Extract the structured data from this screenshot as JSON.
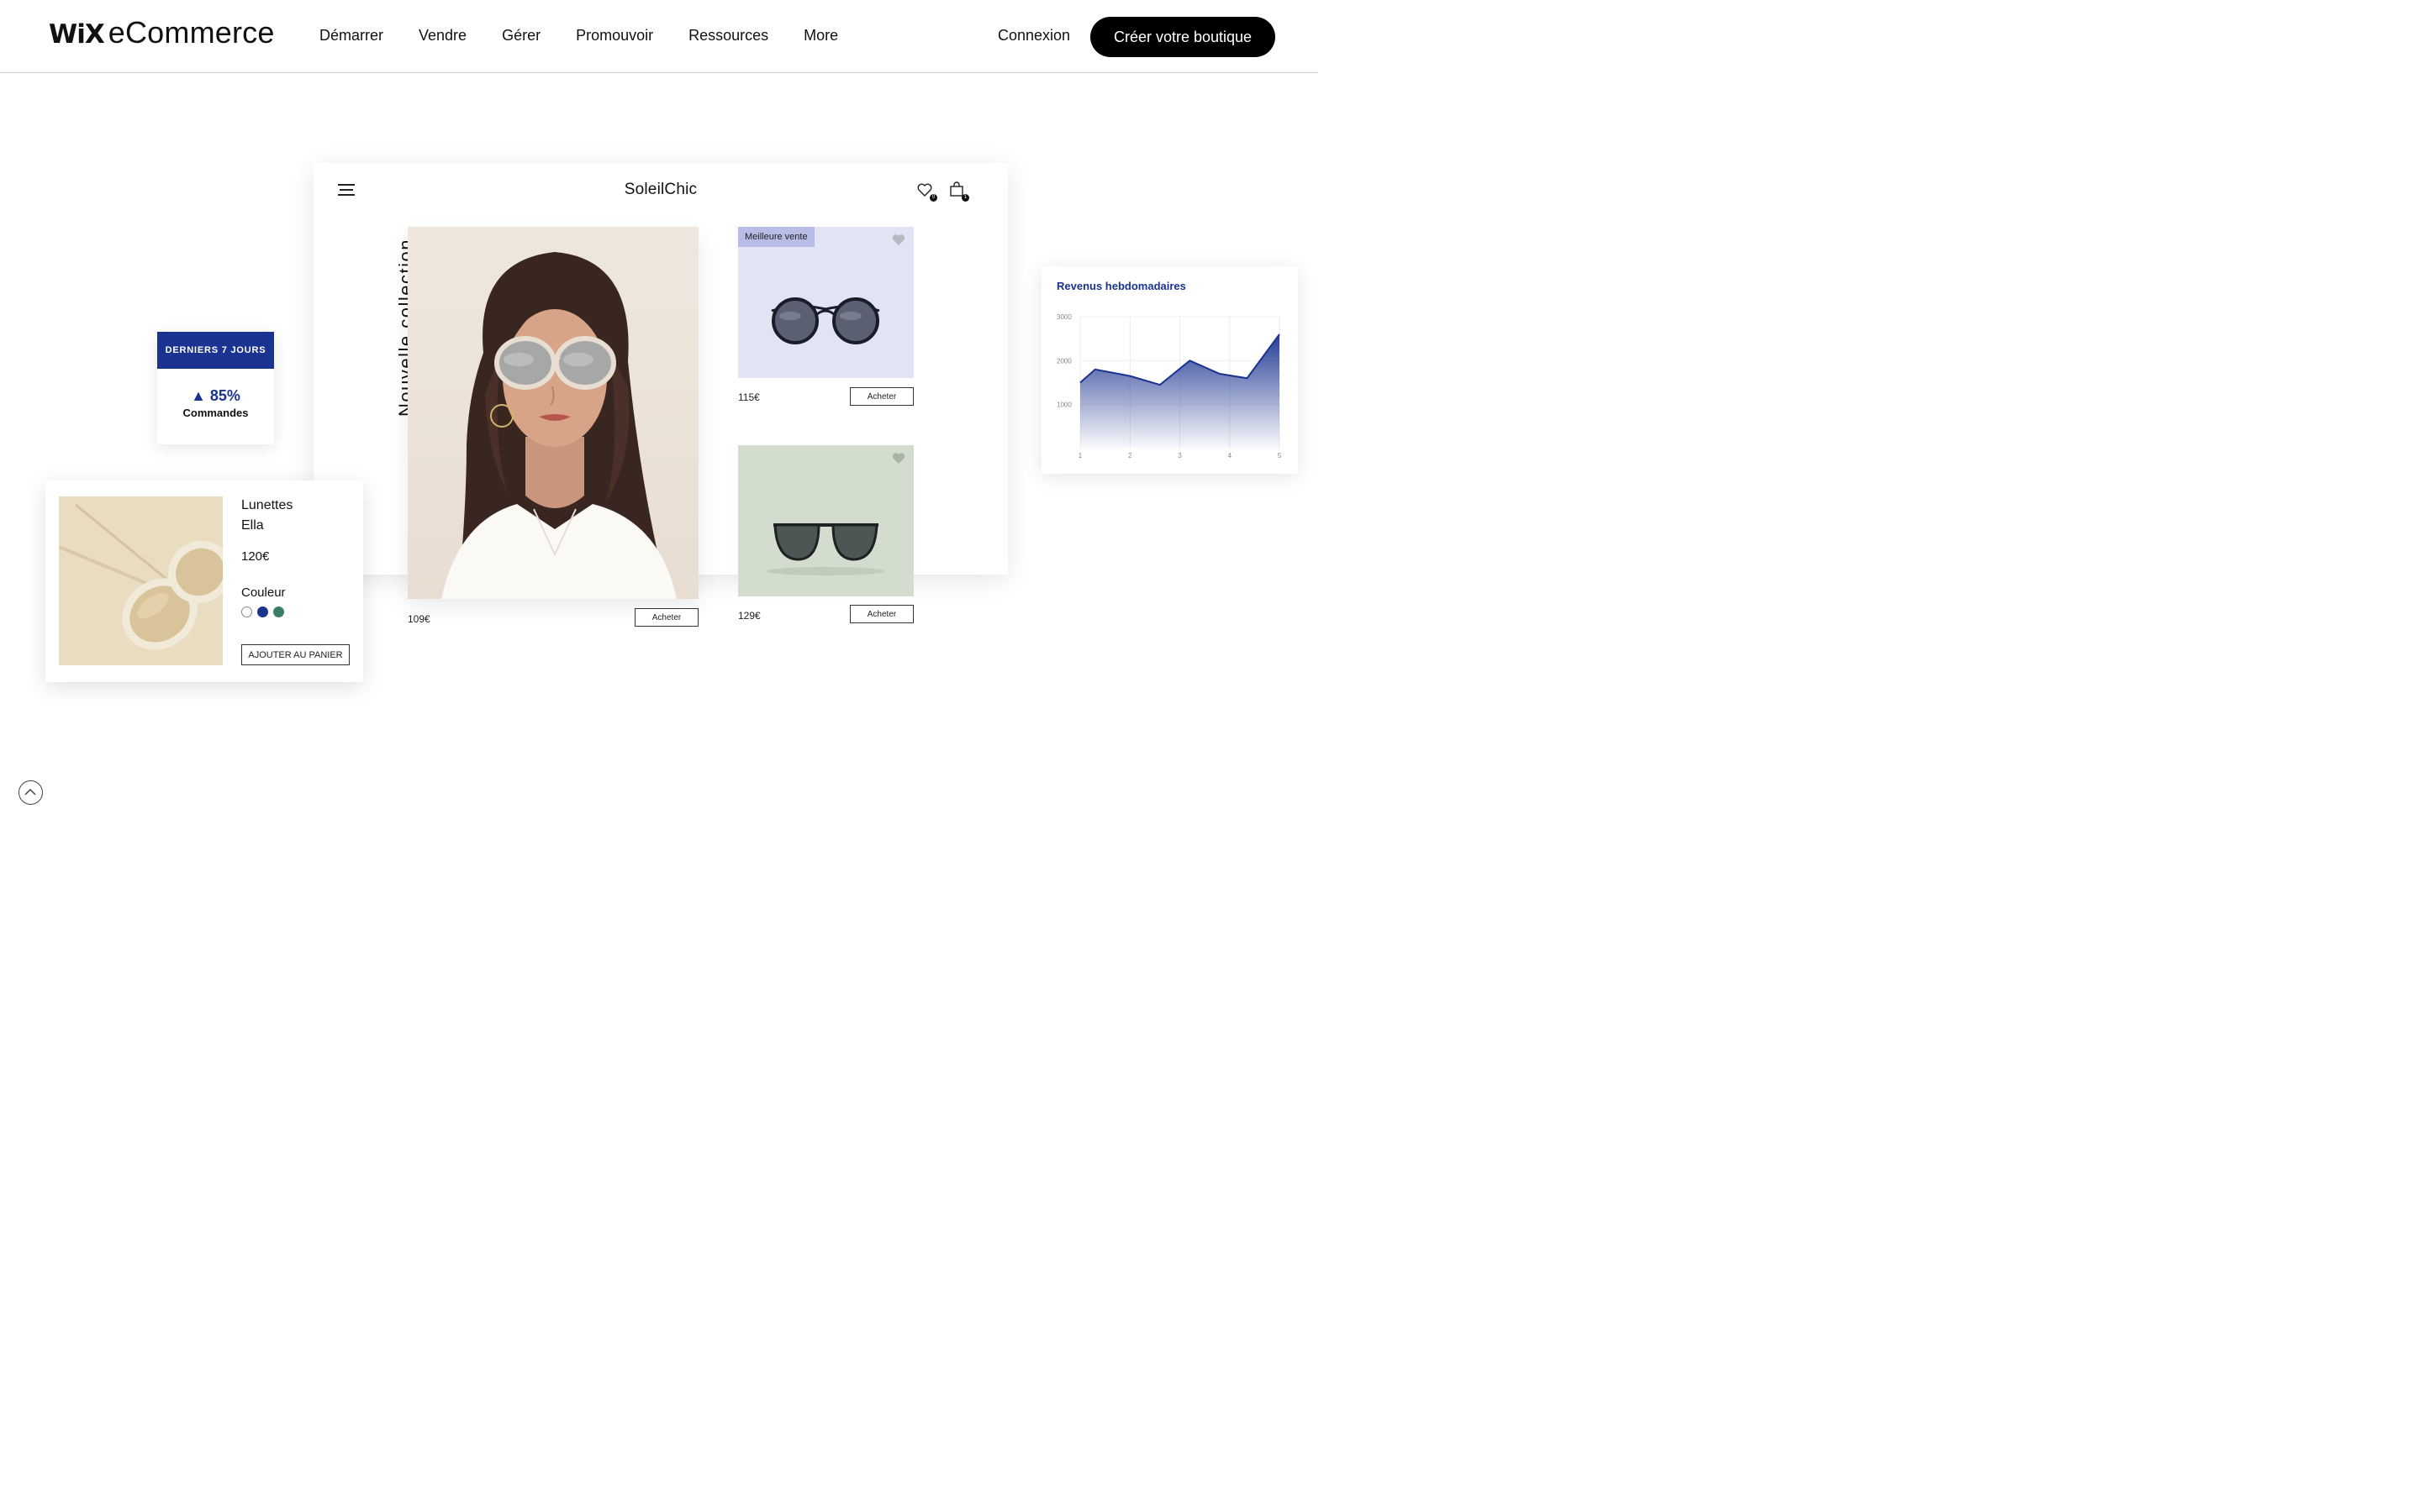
{
  "header": {
    "logo_wix": "WiX",
    "logo_rest": "eCommerce",
    "nav": [
      "Démarrer",
      "Vendre",
      "Gérer",
      "Promouvoir",
      "Ressources",
      "More"
    ],
    "login": "Connexion",
    "cta": "Créer votre boutique"
  },
  "store": {
    "title": "SoleilChic",
    "vertical_label": "Nouvelle collection",
    "wishlist_count": "0",
    "cart_count": "1",
    "hero_price": "109€",
    "buy_label": "Acheter",
    "products": [
      {
        "badge": "Meilleure vente",
        "price": "115€"
      },
      {
        "badge": "",
        "price": "129€"
      }
    ]
  },
  "stats": {
    "header": "DERNIERS 7 JOURS",
    "value": "▲ 85%",
    "label": "Commandes"
  },
  "detail": {
    "name_line1": "Lunettes",
    "name_line2": "Ella",
    "price": "120€",
    "color_label": "Couleur",
    "swatches": [
      "#ffffff",
      "#1b3390",
      "#3c7d63"
    ],
    "add_to_cart": "AJOUTER AU PANIER"
  },
  "chart_data": {
    "type": "area",
    "title": "Revenus hebdomadaires",
    "x": [
      1,
      1.3,
      2,
      2.6,
      3.2,
      3.8,
      4.35,
      5
    ],
    "y": [
      1500,
      1800,
      1650,
      1450,
      2000,
      1700,
      1600,
      2600
    ],
    "ylim": [
      0,
      3000
    ],
    "yticks": [
      1000,
      2000,
      3000
    ],
    "xticks": [
      1,
      2,
      3,
      4,
      5
    ],
    "color": "#1b3390",
    "grid": true
  },
  "colors": {
    "brand_blue": "#1b3390",
    "cta_bg": "#000000"
  }
}
